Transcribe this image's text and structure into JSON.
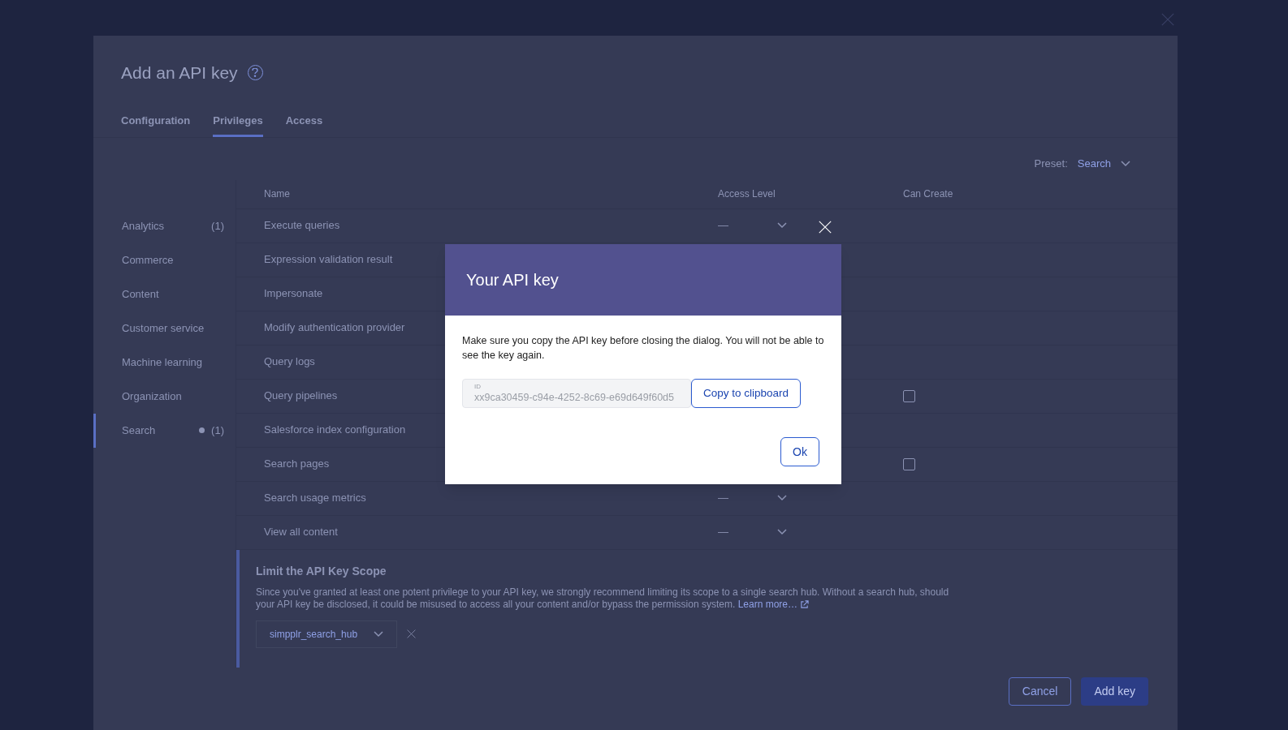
{
  "panel": {
    "title": "Add an API key",
    "tabs": [
      {
        "label": "Configuration",
        "selected": false
      },
      {
        "label": "Privileges",
        "selected": true
      },
      {
        "label": "Access",
        "selected": false
      }
    ],
    "preset": {
      "label": "Preset:",
      "value": "Search"
    },
    "categories": [
      {
        "label": "Analytics",
        "count": "(1)",
        "selected": false,
        "modified": false
      },
      {
        "label": "Commerce",
        "selected": false,
        "modified": false
      },
      {
        "label": "Content",
        "selected": false,
        "modified": false
      },
      {
        "label": "Customer service",
        "selected": false,
        "modified": false
      },
      {
        "label": "Machine learning",
        "selected": false,
        "modified": false
      },
      {
        "label": "Organization",
        "selected": false,
        "modified": false
      },
      {
        "label": "Search",
        "count": "(1)",
        "selected": true,
        "modified": true
      }
    ],
    "table": {
      "columns": [
        "Name",
        "Access Level",
        "Can Create"
      ],
      "rows": [
        {
          "name": "Execute queries",
          "access": "—"
        },
        {
          "name": "Expression validation result"
        },
        {
          "name": "Impersonate"
        },
        {
          "name": "Modify authentication provider"
        },
        {
          "name": "Query logs"
        },
        {
          "name": "Query pipelines",
          "can_create": {
            "checked": false
          }
        },
        {
          "name": "Salesforce index configuration"
        },
        {
          "name": "Search pages",
          "can_create": {
            "checked": false
          }
        },
        {
          "name": "Search usage metrics",
          "access": "—"
        },
        {
          "name": "View all content",
          "access": "—"
        }
      ]
    },
    "scope": {
      "title": "Limit the API Key Scope",
      "text": "Since you've granted at least one potent privilege to your API key, we strongly recommend limiting its scope to a single search hub. Without a search hub, should your API key be disclosed, it could be misused to access all your content and/or bypass the permission system.",
      "link": "Learn more…",
      "hub": "simpplr_search_hub"
    },
    "buttons": [
      {
        "label": "Cancel",
        "kind": "secondary"
      },
      {
        "label": "Add key",
        "kind": "primary"
      }
    ]
  },
  "dialog": {
    "title": "Your API key",
    "message": "Make sure you copy the API key before closing the dialog. You will not be able to see the key again.",
    "field": {
      "label": "ID",
      "value": "xx9ca30459-c94e-4252-8c69-e69d649f60d5"
    },
    "copy_button": "Copy to clipboard",
    "ok_button": "Ok"
  }
}
